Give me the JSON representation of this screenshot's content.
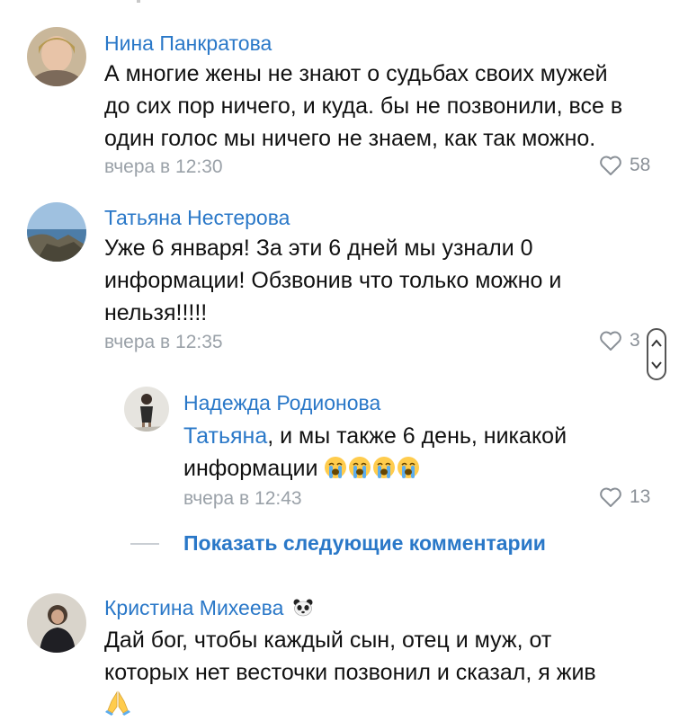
{
  "comments": [
    {
      "author": "Нина Панкратова",
      "lines": [
        "А многие жены не знают о судьбах своих мужей",
        "до сих пор ничего, и куда. бы не позвонили, все в",
        "один голос мы ничего не знаем, как так можно."
      ],
      "time": "вчера в 12:30",
      "likes": "58"
    },
    {
      "author": "Татьяна Нестерова",
      "lines": [
        "Уже 6 января! За эти 6 дней мы узнали 0",
        "информации! Обзвонив что только можно и",
        "нельзя!!!!!"
      ],
      "time": "вчера в 12:35",
      "likes": "3"
    }
  ],
  "reply": {
    "author": "Надежда Родионова",
    "mention": "Татьяна",
    "line1_rest": ", и мы также 6 день, никакой",
    "line2": "информации",
    "emoji_name": "loudly-crying-face-icon",
    "time": "вчера в 12:43",
    "likes": "13"
  },
  "show_more": "Показать следующие комментарии",
  "last_comment": {
    "author": "Кристина Михеева",
    "author_badge_icon": "panda-face-icon",
    "lines": [
      "Дай бог, чтобы каждый сын, отец и муж, от",
      "которых нет весточки позвонил и сказал, я жив"
    ],
    "trailing_icon": "folded-hands-icon"
  },
  "colors": {
    "link": "#2a78c8",
    "meta": "#9aa1a8",
    "text": "#111111"
  }
}
